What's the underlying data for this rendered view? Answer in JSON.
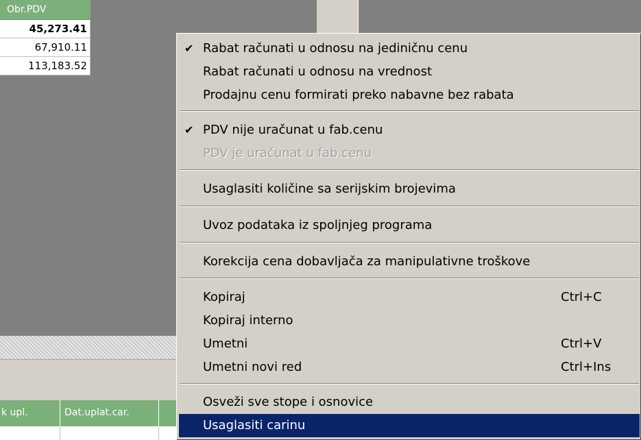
{
  "top_grid": {
    "header": "Obr.PDV",
    "values": [
      "45,273.41",
      "67,910.11",
      "113,183.52"
    ]
  },
  "bottom_grid": {
    "headers": [
      "k upl.",
      "Dat.uplat.car."
    ]
  },
  "context_menu": {
    "items": [
      {
        "label": "Rabat računati u odnosu na jediničnu cenu",
        "checked": true
      },
      {
        "label": "Rabat računati u odnosu na vrednost"
      },
      {
        "label": "Prodajnu cenu formirati preko nabavne bez rabata"
      },
      {
        "label": "PDV nije uračunat u fab.cenu",
        "checked": true
      },
      {
        "label": "PDV je uračunat u fab.cenu",
        "disabled": true
      },
      {
        "label": "Usaglasiti količine sa serijskim brojevima"
      },
      {
        "label": "Uvoz podataka iz spoljnjeg programa"
      },
      {
        "label": "Korekcija cena dobavljača za manipulativne troškove"
      },
      {
        "label": "Kopiraj",
        "shortcut": "Ctrl+C"
      },
      {
        "label": "Kopiraj interno"
      },
      {
        "label": "Umetni",
        "shortcut": "Ctrl+V"
      },
      {
        "label": "Umetni novi red",
        "shortcut": "Ctrl+Ins"
      },
      {
        "label": "Osveži sve stope i osnovice"
      },
      {
        "label": "Usaglasiti carinu",
        "selected": true
      }
    ],
    "check_glyph": "✔"
  },
  "colors": {
    "grid_header": "#7bb07b",
    "menu_background": "#d4d0c8",
    "selection": "#0a246a",
    "desktop_gray": "#808080"
  }
}
